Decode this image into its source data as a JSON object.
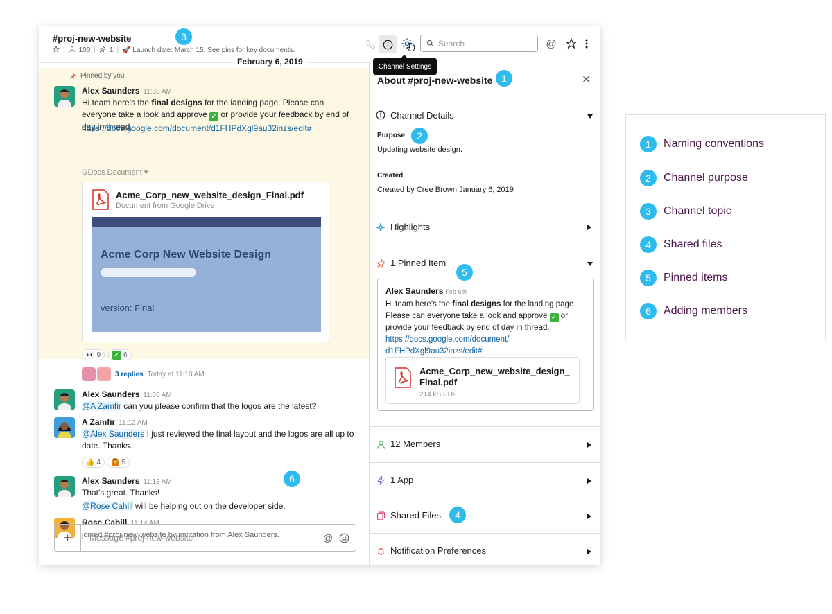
{
  "header": {
    "channel_name": "#proj-new-website",
    "members_count": "100",
    "pins_count": "1",
    "topic": "🚀 Launch date: March 15. See pins for key documents.",
    "search_placeholder": "Search",
    "tooltip": "Channel Settings"
  },
  "date_divider": "February 6, 2019",
  "messages": {
    "pinned_by": "Pinned by you",
    "m1": {
      "author": "Alex Saunders",
      "time": "11:03 AM",
      "text_a": "Hi team here's the ",
      "text_bold": "final designs",
      "text_b": " for the landing page. Please can everyone take a look and approve ",
      "text_c": " or provide your feedback by end of day in thread.",
      "link": "https://docs.google.com/document/d1FHPdXgl9au32inzs/edit#",
      "gdocs_label": "GDocs Document",
      "file_name": "Acme_Corp_new_website_design_Final.pdf",
      "file_sub": "Document from Google Drive",
      "preview_title": "Acme Corp New Website Design",
      "preview_version": "version: Final",
      "reaction_eyes": "9",
      "reaction_check": "6",
      "replies": "3 replies",
      "replies_time": "Today at 11:18 AM"
    },
    "m2": {
      "author": "Alex Saunders",
      "time": "11:05 AM",
      "mention": "@A Zamfir",
      "text": " can you please confirm that the logos are the latest?"
    },
    "m3": {
      "author": "A Zamfir",
      "time": "11:12 AM",
      "mention": "@Alex Saunders",
      "text": " I just reviewed the final layout and the logos are all up to date. Thanks.",
      "reaction_thumbs": "4",
      "reaction_person": "5"
    },
    "m4": {
      "author": "Alex Saunders",
      "time": "11:13 AM",
      "text": "That's great. Thanks!",
      "mention": "@Rose Cahill",
      "text2": " will be helping out on the developer side."
    },
    "m5": {
      "author": "Rose Cahill",
      "time": "11:14 AM",
      "text": "joined #proj-new-website by invitation from Alex Saunders."
    }
  },
  "composer": {
    "placeholder": "Message #proj-new-website"
  },
  "panel": {
    "title": "About #proj-new-website",
    "details_title": "Channel Details",
    "purpose_label": "Purpose",
    "purpose_value": "Updating website design.",
    "created_label": "Created",
    "created_value": "Created by Cree Brown January 6, 2019",
    "highlights": "Highlights",
    "pinned_title": "1 Pinned Item",
    "pin_author": "Alex Saunders",
    "pin_time": "Feb 6th",
    "pin_text_a": "Hi team here's the ",
    "pin_text_bold": "final designs",
    "pin_text_b": " for the landing page. Please can everyone take a look and approve ",
    "pin_text_c": " or provide your feedback by end of day in thread.",
    "pin_link_1": "https://docs.google.com/document/",
    "pin_link_2": "d1FHPdXgl9au32inzs/edit#",
    "pin_file_1": "Acme_Corp_new_website_design_",
    "pin_file_2": "Final.pdf",
    "pin_file_size": "214 kB PDF",
    "members": "12 Members",
    "apps": "1 App",
    "shared_files": "Shared Files",
    "notifications": "Notification Preferences"
  },
  "badges": [
    "1",
    "2",
    "3",
    "4",
    "5",
    "6"
  ],
  "legend": [
    {
      "num": "1",
      "label": "Naming conventions"
    },
    {
      "num": "2",
      "label": "Channel purpose"
    },
    {
      "num": "3",
      "label": "Channel topic"
    },
    {
      "num": "4",
      "label": "Shared files"
    },
    {
      "num": "5",
      "label": "Pinned items"
    },
    {
      "num": "6",
      "label": "Adding members"
    }
  ],
  "colors": {
    "accent": "#2ebcee",
    "legend_text": "#4a154b",
    "link": "#1264a3",
    "pinned_bg": "#fdf8e4"
  }
}
